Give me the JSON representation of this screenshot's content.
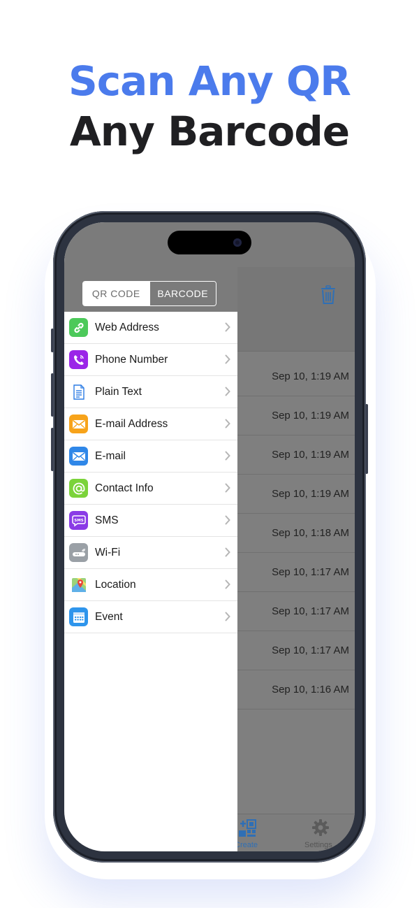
{
  "headline": {
    "line1": "Scan Any QR",
    "line2": "Any Barcode",
    "line1_color": "#4b7bec"
  },
  "segment": {
    "qr_label": "QR CODE",
    "barcode_label": "BARCODE",
    "selected": "QR CODE"
  },
  "menu": {
    "items": [
      {
        "label": "Web Address",
        "icon": "link-icon",
        "color": "#4cc95a"
      },
      {
        "label": "Phone Number",
        "icon": "phone-icon",
        "color": "#9b25e8"
      },
      {
        "label": "Plain Text",
        "icon": "document-icon",
        "color": "#2a7be4"
      },
      {
        "label": "E-mail Address",
        "icon": "envelope-icon",
        "color": "#f7a31a"
      },
      {
        "label": "E-mail",
        "icon": "envelope-icon",
        "color": "#2f87e8"
      },
      {
        "label": "Contact Info",
        "icon": "at-sign-icon",
        "color": "#7bd33a"
      },
      {
        "label": "SMS",
        "icon": "sms-bubble-icon",
        "color": "#8a3be6"
      },
      {
        "label": "Wi-Fi",
        "icon": "wifi-router-icon",
        "color": "#9aa0a6"
      },
      {
        "label": "Location",
        "icon": "map-pin-icon",
        "color": "#f3c53a"
      },
      {
        "label": "Event",
        "icon": "calendar-icon",
        "color": "#2e95ec"
      }
    ]
  },
  "history": {
    "rows": [
      {
        "time": "Sep 10, 1:19 AM"
      },
      {
        "time": "Sep 10, 1:19 AM"
      },
      {
        "time": "Sep 10, 1:19 AM"
      },
      {
        "time": "Sep 10, 1:19 AM"
      },
      {
        "time": "Sep 10, 1:18 AM"
      },
      {
        "time": "Sep 10, 1:17 AM"
      },
      {
        "time": "Sep 10, 1:17 AM"
      },
      {
        "time": "Sep 10, 1:17 AM"
      },
      {
        "time": "Sep 10, 1:16 AM"
      }
    ]
  },
  "tabbar": {
    "create_label": "Create",
    "settings_label": "Settings",
    "active_color": "#2f6fb5"
  }
}
